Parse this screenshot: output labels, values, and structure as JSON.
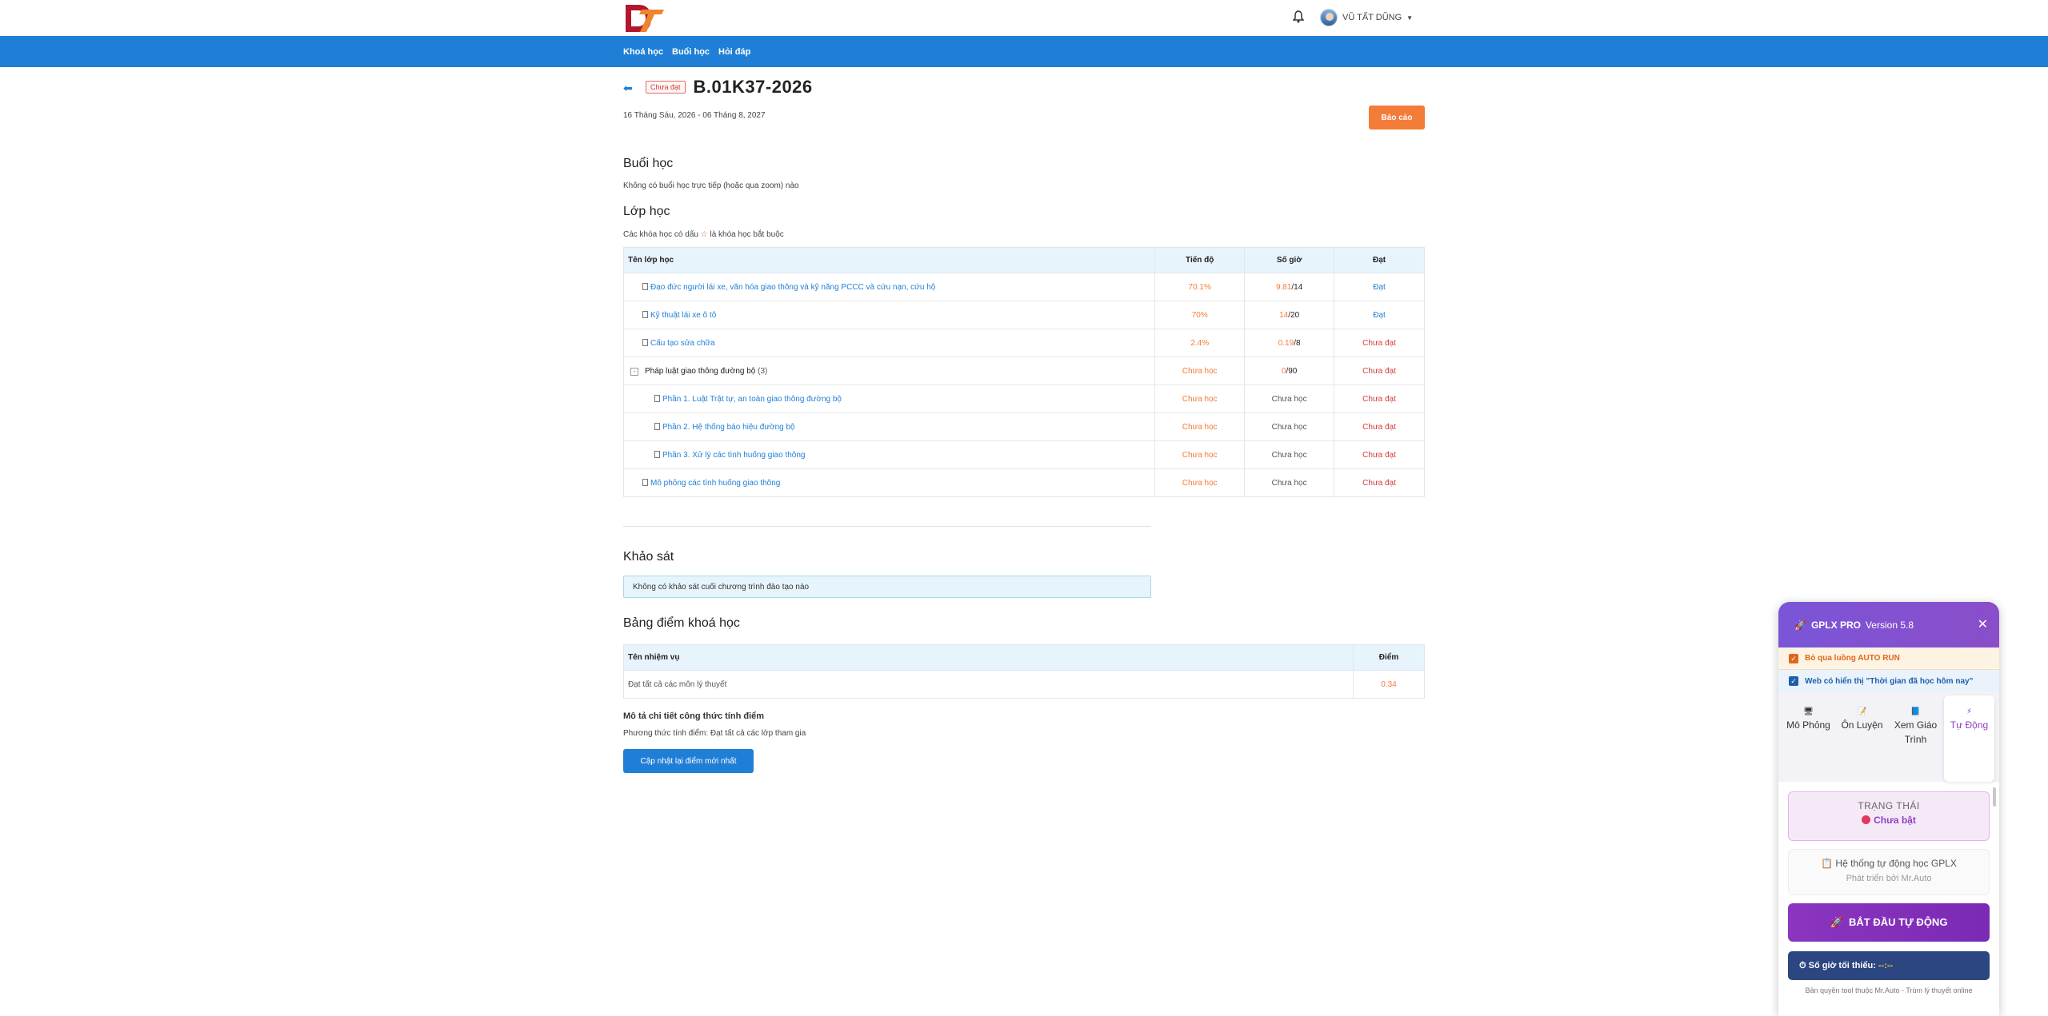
{
  "header": {
    "user_name": "VŨ TẤT DŨNG",
    "nav": [
      "Khoá học",
      "Buổi học",
      "Hỏi đáp"
    ]
  },
  "course": {
    "status_badge": "Chưa đạt",
    "code": "B.01K37-2026",
    "dates": "16 Tháng Sáu, 2026 - 06 Tháng 8, 2027",
    "report_label": "Báo cáo"
  },
  "sessions": {
    "title": "Buổi học",
    "empty": "Không có buổi học trực tiếp (hoặc qua zoom) nào"
  },
  "classes": {
    "title": "Lớp học",
    "note_prefix": "Các khóa học có dấu",
    "note_star": "☆",
    "note_suffix": "là khóa học bắt buộc",
    "headers": [
      "Tên lớp học",
      "Tiến độ",
      "Số giờ",
      "Đạt"
    ],
    "rows": [
      {
        "name": "Đạo đức người lái xe, văn hóa giao thông và kỹ năng PCCC và cứu nạn, cứu hộ",
        "progress": "70.1%",
        "hours_done": "9.81",
        "hours_total": "/14",
        "pass": "Đạt"
      },
      {
        "name": "Kỹ thuật lái xe ô tô",
        "progress": "70%",
        "hours_done": "14",
        "hours_total": "/20",
        "pass": "Đạt"
      },
      {
        "name": "Cấu tạo sửa chữa",
        "progress": "2.4%",
        "hours_done": "0.19",
        "hours_total": "/8",
        "pass": "Chưa đạt"
      },
      {
        "name": "Pháp luật giao thông đường bộ",
        "count": "(3)",
        "toggle": "-",
        "progress": "Chưa học",
        "hours_done": "0",
        "hours_total": "/90",
        "pass": "Chưa đạt"
      },
      {
        "name": "Phần 1. Luật Trật tự, an toàn giao thông đường bộ",
        "progress": "Chưa học",
        "hours": "Chưa học",
        "pass": "Chưa đạt"
      },
      {
        "name": "Phần 2. Hệ thống báo hiệu đường bộ",
        "progress": "Chưa học",
        "hours": "Chưa học",
        "pass": "Chưa đạt"
      },
      {
        "name": "Phần 3. Xử lý các tình huống giao thông",
        "progress": "Chưa học",
        "hours": "Chưa học",
        "pass": "Chưa đạt"
      },
      {
        "name": "Mô phỏng các tình huống giao thông",
        "progress": "Chưa học",
        "hours": "Chưa học",
        "pass": "Chưa đạt"
      }
    ]
  },
  "survey": {
    "title": "Khảo sát",
    "empty": "Không có khảo sát cuối chương trình đào tạo nào"
  },
  "scores": {
    "title": "Bảng điểm khoá học",
    "headers": [
      "Tên nhiệm vụ",
      "Điểm"
    ],
    "rows": [
      {
        "task": "Đạt tất cả các môn lý thuyết",
        "score": "0.34"
      }
    ],
    "formula_title": "Mô tả chi tiết công thức tính điểm",
    "formula_text": "Phương thức tính điểm: Đạt tất cả các lớp tham gia",
    "update_label": "Cập nhật lại điểm mới nhất"
  },
  "panel": {
    "name": "GPLX PRO",
    "version": "Version 5.8",
    "close": "✕",
    "opt1": "Bỏ qua luồng AUTO RUN",
    "opt2": "Web có hiển thị \"Thời gian đã học hôm nay\"",
    "tabs": [
      {
        "icon": "🖥",
        "label": "Mô Phỏng"
      },
      {
        "icon": "📝",
        "label": "Ôn Luyện"
      },
      {
        "icon": "📘",
        "label": "Xem Giáo Trình"
      },
      {
        "icon": "⚡",
        "label": "Tự Động"
      }
    ],
    "status_label": "TRẠNG THÁI",
    "status_value": "Chưa bật",
    "system_label": "Hệ thống tự động học GPLX",
    "system_icon": "📋",
    "system_sub": "Phát triển bởi Mr.Auto",
    "start_icon": "🚀",
    "start_label": "BẮT ĐẦU TỰ ĐỘNG",
    "min_hours_icon": "⏱",
    "min_hours_label": "Số giờ tối thiểu:",
    "min_hours_value": "--:--",
    "copyright": "Bản quyền tool thuộc Mr.Auto - Trùm lý thuyết online",
    "colors": {
      "accent": "#8e3ec7",
      "header": "#7a55d8"
    }
  },
  "colors": {
    "brand_blue": "#1f7fd6",
    "orange": "#f37c38",
    "red": "#d43b3b"
  }
}
